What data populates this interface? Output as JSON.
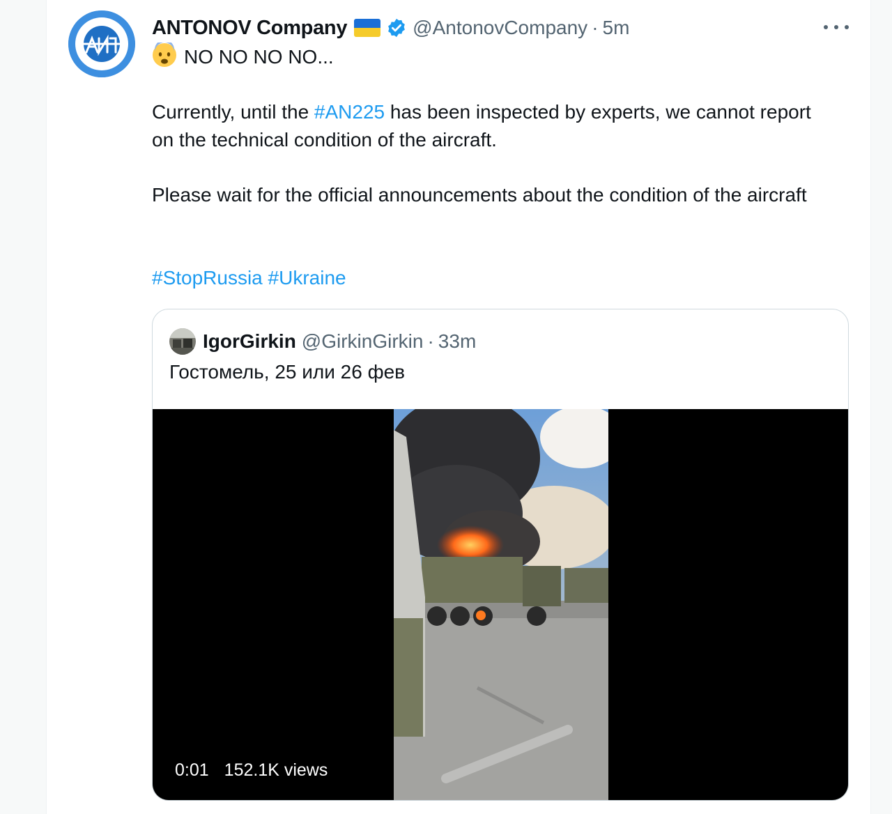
{
  "tweet": {
    "display_name": "ANTONOV Company",
    "handle": "@AntonovCompany",
    "separator": "·",
    "time": "5m",
    "avatar_icon": "antonov-logo",
    "flag_icon": "ukraine-flag-icon",
    "verified_icon": "verified-badge-icon",
    "more_icon": "more-options-icon",
    "emoji_icon": "fearful-face-emoji",
    "line1": "NO NO NO NO...",
    "para1_pre": "Currently, until the ",
    "para1_tag": "#AN225",
    "para1_post": " has been inspected by experts, we cannot report on the technical condition of the aircraft.",
    "para2": "Please wait for the official announcements about the condition of the aircraft",
    "tag1": "#StopRussia",
    "tag2": "#Ukraine"
  },
  "quoted": {
    "display_name": "IgorGirkin",
    "handle": "@GirkinGirkin",
    "separator": "·",
    "time": "33m",
    "text": "Гостомель, 25 или 26 фев",
    "video": {
      "timestamp": "0:01",
      "views": "152.1K views"
    }
  },
  "colors": {
    "accent": "#1d9bf0",
    "secondary_text": "#536471",
    "border": "#cfd9de",
    "flag_blue": "#1a6fd6",
    "flag_yellow": "#f5cb2a"
  }
}
